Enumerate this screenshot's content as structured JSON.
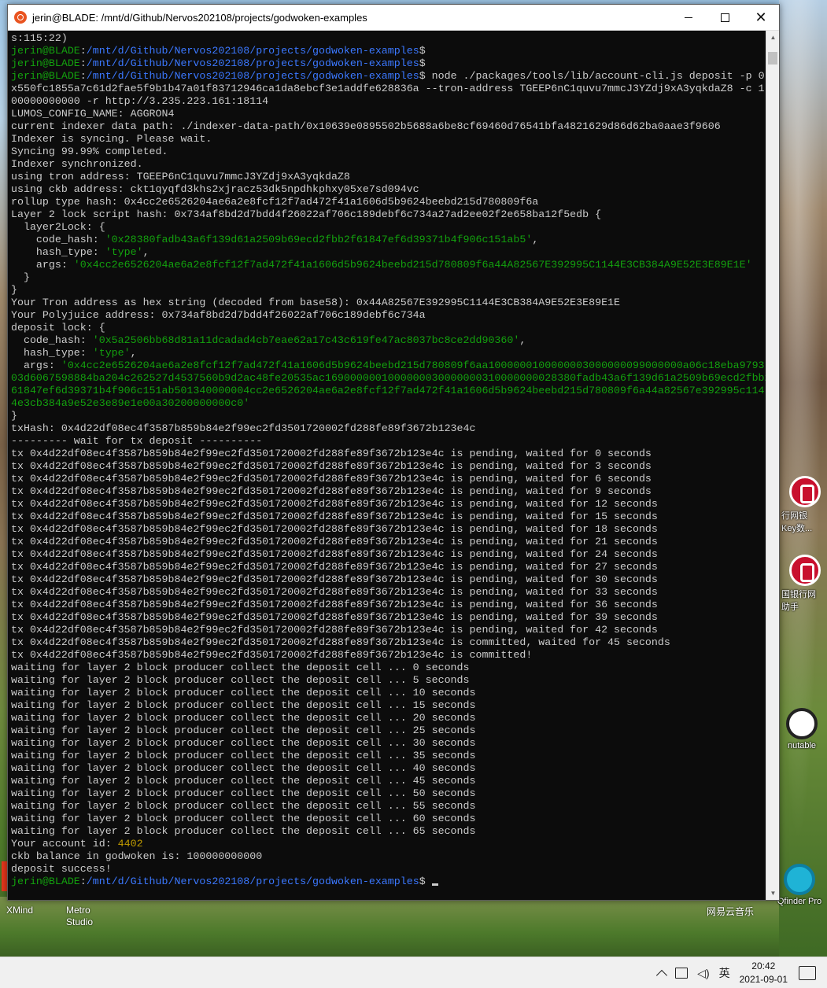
{
  "window": {
    "title": "jerin@BLADE: /mnt/d/Github/Nervos202108/projects/godwoken-examples",
    "minimize": "",
    "maximize": "",
    "close": "✕"
  },
  "prompt": {
    "user": "jerin@BLADE",
    "path": "/mnt/d/Github/Nervos202108/projects/godwoken-examples",
    "symbol": "$"
  },
  "terminal": {
    "lines": [
      [
        {
          "t": "s:115:22)"
        }
      ],
      [
        {
          "t": "jerin@BLADE",
          "c": "g"
        },
        {
          "t": ":"
        },
        {
          "t": "/mnt/d/Github/Nervos202108/projects/godwoken-examples",
          "c": "b"
        },
        {
          "t": "$"
        }
      ],
      [
        {
          "t": "jerin@BLADE",
          "c": "g"
        },
        {
          "t": ":"
        },
        {
          "t": "/mnt/d/Github/Nervos202108/projects/godwoken-examples",
          "c": "b"
        },
        {
          "t": "$"
        }
      ],
      [
        {
          "t": "jerin@BLADE",
          "c": "g"
        },
        {
          "t": ":"
        },
        {
          "t": "/mnt/d/Github/Nervos202108/projects/godwoken-examples",
          "c": "b"
        },
        {
          "t": "$ node ./packages/tools/lib/account-cli.js deposit -p 0"
        }
      ],
      [
        {
          "t": "x550fc1855a7c61d2fae5f9b1b47a01f83712946ca1da8ebcf3e1addfe628836a --tron-address TGEEP6nC1quvu7mmcJ3YZdj9xA3yqkdaZ8 -c 1"
        }
      ],
      [
        {
          "t": "00000000000 -r http://3.235.223.161:18114"
        }
      ],
      [
        {
          "t": "LUMOS_CONFIG_NAME: AGGRON4"
        }
      ],
      [
        {
          "t": "current indexer data path: ./indexer-data-path/0x10639e0895502b5688a6be8cf69460d76541bfa4821629d86d62ba0aae3f9606"
        }
      ],
      [
        {
          "t": "Indexer is syncing. Please wait."
        }
      ],
      [
        {
          "t": "Syncing 99.99% completed."
        }
      ],
      [
        {
          "t": "Indexer synchronized."
        }
      ],
      [
        {
          "t": "using tron address: TGEEP6nC1quvu7mmcJ3YZdj9xA3yqkdaZ8"
        }
      ],
      [
        {
          "t": "using ckb address: ckt1qyqfd3khs2xjracz53dk5npdhkphxy05xe7sd094vc"
        }
      ],
      [
        {
          "t": "rollup type hash: 0x4cc2e6526204ae6a2e8fcf12f7ad472f41a1606d5b9624beebd215d780809f6a"
        }
      ],
      [
        {
          "t": "Layer 2 lock script hash: 0x734af8bd2d7bdd4f26022af706c189debf6c734a27ad2ee02f2e658ba12f5edb {"
        }
      ],
      [
        {
          "t": "  layer2Lock: {"
        }
      ],
      [
        {
          "t": "    code_hash: "
        },
        {
          "t": "'0x28380fadb43a6f139d61a2509b69ecd2fbb2f61847ef6d39371b4f906c151ab5'",
          "c": "g"
        },
        {
          "t": ","
        }
      ],
      [
        {
          "t": "    hash_type: "
        },
        {
          "t": "'type'",
          "c": "g"
        },
        {
          "t": ","
        }
      ],
      [
        {
          "t": "    args: "
        },
        {
          "t": "'0x4cc2e6526204ae6a2e8fcf12f7ad472f41a1606d5b9624beebd215d780809f6a44A82567E392995C1144E3CB384A9E52E3E89E1E'",
          "c": "g"
        }
      ],
      [
        {
          "t": "  }"
        }
      ],
      [
        {
          "t": "}"
        }
      ],
      [
        {
          "t": "Your Tron address as hex string (decoded from base58): 0x44A82567E392995C1144E3CB384A9E52E3E89E1E"
        }
      ],
      [
        {
          "t": "Your Polyjuice address: 0x734af8bd2d7bdd4f26022af706c189debf6c734a"
        }
      ],
      [
        {
          "t": "deposit lock: {"
        }
      ],
      [
        {
          "t": "  code_hash: "
        },
        {
          "t": "'0x5a2506bb68d81a11dcadad4cb7eae62a17c43c619fe47ac8037bc8ce2dd90360'",
          "c": "g"
        },
        {
          "t": ","
        }
      ],
      [
        {
          "t": "  hash_type: "
        },
        {
          "t": "'type'",
          "c": "g"
        },
        {
          "t": ","
        }
      ],
      [
        {
          "t": "  args: "
        },
        {
          "t": "'0x4cc2e6526204ae6a2e8fcf12f7ad472f41a1606d5b9624beebd215d780809f6aa1000000100000003000000099000000a06c18eba9793",
          "c": "g"
        }
      ],
      [
        {
          "t": "03d6067598884ba204c262527d4537560b9d2ac48fe20535ac1690000001000000030000000310000000028380fadb43a6f139d61a2509b69ecd2fbb2f",
          "c": "g"
        }
      ],
      [
        {
          "t": "61847ef6d39371b4f906c151ab501340000004cc2e6526204ae6a2e8fcf12f7ad472f41a1606d5b9624beebd215d780809f6a44a82567e392995c114",
          "c": "g"
        }
      ],
      [
        {
          "t": "4e3cb384a9e52e3e89e1e00a30200000000c0'",
          "c": "g"
        }
      ],
      [
        {
          "t": "}"
        }
      ],
      [
        {
          "t": "txHash: 0x4d22df08ec4f3587b859b84e2f99ec2fd3501720002fd288fe89f3672b123e4c"
        }
      ],
      [
        {
          "t": "--------- wait for tx deposit ----------"
        }
      ],
      [
        {
          "t": "tx 0x4d22df08ec4f3587b859b84e2f99ec2fd3501720002fd288fe89f3672b123e4c is pending, waited for 0 seconds"
        }
      ],
      [
        {
          "t": "tx 0x4d22df08ec4f3587b859b84e2f99ec2fd3501720002fd288fe89f3672b123e4c is pending, waited for 3 seconds"
        }
      ],
      [
        {
          "t": "tx 0x4d22df08ec4f3587b859b84e2f99ec2fd3501720002fd288fe89f3672b123e4c is pending, waited for 6 seconds"
        }
      ],
      [
        {
          "t": "tx 0x4d22df08ec4f3587b859b84e2f99ec2fd3501720002fd288fe89f3672b123e4c is pending, waited for 9 seconds"
        }
      ],
      [
        {
          "t": "tx 0x4d22df08ec4f3587b859b84e2f99ec2fd3501720002fd288fe89f3672b123e4c is pending, waited for 12 seconds"
        }
      ],
      [
        {
          "t": "tx 0x4d22df08ec4f3587b859b84e2f99ec2fd3501720002fd288fe89f3672b123e4c is pending, waited for 15 seconds"
        }
      ],
      [
        {
          "t": "tx 0x4d22df08ec4f3587b859b84e2f99ec2fd3501720002fd288fe89f3672b123e4c is pending, waited for 18 seconds"
        }
      ],
      [
        {
          "t": "tx 0x4d22df08ec4f3587b859b84e2f99ec2fd3501720002fd288fe89f3672b123e4c is pending, waited for 21 seconds"
        }
      ],
      [
        {
          "t": "tx 0x4d22df08ec4f3587b859b84e2f99ec2fd3501720002fd288fe89f3672b123e4c is pending, waited for 24 seconds"
        }
      ],
      [
        {
          "t": "tx 0x4d22df08ec4f3587b859b84e2f99ec2fd3501720002fd288fe89f3672b123e4c is pending, waited for 27 seconds"
        }
      ],
      [
        {
          "t": "tx 0x4d22df08ec4f3587b859b84e2f99ec2fd3501720002fd288fe89f3672b123e4c is pending, waited for 30 seconds"
        }
      ],
      [
        {
          "t": "tx 0x4d22df08ec4f3587b859b84e2f99ec2fd3501720002fd288fe89f3672b123e4c is pending, waited for 33 seconds"
        }
      ],
      [
        {
          "t": "tx 0x4d22df08ec4f3587b859b84e2f99ec2fd3501720002fd288fe89f3672b123e4c is pending, waited for 36 seconds"
        }
      ],
      [
        {
          "t": "tx 0x4d22df08ec4f3587b859b84e2f99ec2fd3501720002fd288fe89f3672b123e4c is pending, waited for 39 seconds"
        }
      ],
      [
        {
          "t": "tx 0x4d22df08ec4f3587b859b84e2f99ec2fd3501720002fd288fe89f3672b123e4c is pending, waited for 42 seconds"
        }
      ],
      [
        {
          "t": "tx 0x4d22df08ec4f3587b859b84e2f99ec2fd3501720002fd288fe89f3672b123e4c is committed, waited for 45 seconds"
        }
      ],
      [
        {
          "t": "tx 0x4d22df08ec4f3587b859b84e2f99ec2fd3501720002fd288fe89f3672b123e4c is committed!"
        }
      ],
      [
        {
          "t": "waiting for layer 2 block producer collect the deposit cell ... 0 seconds"
        }
      ],
      [
        {
          "t": "waiting for layer 2 block producer collect the deposit cell ... 5 seconds"
        }
      ],
      [
        {
          "t": "waiting for layer 2 block producer collect the deposit cell ... 10 seconds"
        }
      ],
      [
        {
          "t": "waiting for layer 2 block producer collect the deposit cell ... 15 seconds"
        }
      ],
      [
        {
          "t": "waiting for layer 2 block producer collect the deposit cell ... 20 seconds"
        }
      ],
      [
        {
          "t": "waiting for layer 2 block producer collect the deposit cell ... 25 seconds"
        }
      ],
      [
        {
          "t": "waiting for layer 2 block producer collect the deposit cell ... 30 seconds"
        }
      ],
      [
        {
          "t": "waiting for layer 2 block producer collect the deposit cell ... 35 seconds"
        }
      ],
      [
        {
          "t": "waiting for layer 2 block producer collect the deposit cell ... 40 seconds"
        }
      ],
      [
        {
          "t": "waiting for layer 2 block producer collect the deposit cell ... 45 seconds"
        }
      ],
      [
        {
          "t": "waiting for layer 2 block producer collect the deposit cell ... 50 seconds"
        }
      ],
      [
        {
          "t": "waiting for layer 2 block producer collect the deposit cell ... 55 seconds"
        }
      ],
      [
        {
          "t": "waiting for layer 2 block producer collect the deposit cell ... 60 seconds"
        }
      ],
      [
        {
          "t": "waiting for layer 2 block producer collect the deposit cell ... 65 seconds"
        }
      ],
      [
        {
          "t": "Your account id: "
        },
        {
          "t": "4402",
          "c": "y"
        }
      ],
      [
        {
          "t": "ckb balance in godwoken is: 100000000000"
        }
      ],
      [
        {
          "t": "deposit success!"
        }
      ],
      [
        {
          "t": "jerin@BLADE",
          "c": "g"
        },
        {
          "t": ":"
        },
        {
          "t": "/mnt/d/Github/Nervos202108/projects/godwoken-examples",
          "c": "b"
        },
        {
          "t": "$ "
        }
      ]
    ]
  },
  "desktop": {
    "icons": [
      {
        "name": "boc-icon-1",
        "label": "行网银\nKey数..."
      },
      {
        "name": "boc-icon-2",
        "label": "国银行网\n助手"
      },
      {
        "name": "immutable-icon",
        "label": "nutable"
      },
      {
        "name": "qfinder-icon",
        "label": "Qfinder Pro"
      }
    ],
    "left_labels": [
      "XMind",
      "Metro\nStudio",
      "网易云音乐"
    ]
  },
  "taskbar": {
    "ime": "英",
    "time": "20:42",
    "date": "2021-09-01"
  }
}
